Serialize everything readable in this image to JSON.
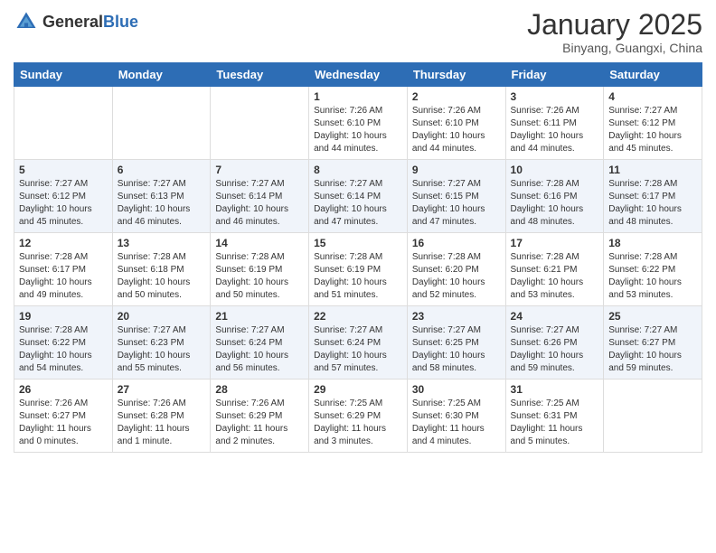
{
  "header": {
    "logo_general": "General",
    "logo_blue": "Blue",
    "title": "January 2025",
    "subtitle": "Binyang, Guangxi, China"
  },
  "weekdays": [
    "Sunday",
    "Monday",
    "Tuesday",
    "Wednesday",
    "Thursday",
    "Friday",
    "Saturday"
  ],
  "weeks": [
    [
      {
        "day": "",
        "sunrise": "",
        "sunset": "",
        "daylight": ""
      },
      {
        "day": "",
        "sunrise": "",
        "sunset": "",
        "daylight": ""
      },
      {
        "day": "",
        "sunrise": "",
        "sunset": "",
        "daylight": ""
      },
      {
        "day": "1",
        "sunrise": "Sunrise: 7:26 AM",
        "sunset": "Sunset: 6:10 PM",
        "daylight": "Daylight: 10 hours and 44 minutes."
      },
      {
        "day": "2",
        "sunrise": "Sunrise: 7:26 AM",
        "sunset": "Sunset: 6:10 PM",
        "daylight": "Daylight: 10 hours and 44 minutes."
      },
      {
        "day": "3",
        "sunrise": "Sunrise: 7:26 AM",
        "sunset": "Sunset: 6:11 PM",
        "daylight": "Daylight: 10 hours and 44 minutes."
      },
      {
        "day": "4",
        "sunrise": "Sunrise: 7:27 AM",
        "sunset": "Sunset: 6:12 PM",
        "daylight": "Daylight: 10 hours and 45 minutes."
      }
    ],
    [
      {
        "day": "5",
        "sunrise": "Sunrise: 7:27 AM",
        "sunset": "Sunset: 6:12 PM",
        "daylight": "Daylight: 10 hours and 45 minutes."
      },
      {
        "day": "6",
        "sunrise": "Sunrise: 7:27 AM",
        "sunset": "Sunset: 6:13 PM",
        "daylight": "Daylight: 10 hours and 46 minutes."
      },
      {
        "day": "7",
        "sunrise": "Sunrise: 7:27 AM",
        "sunset": "Sunset: 6:14 PM",
        "daylight": "Daylight: 10 hours and 46 minutes."
      },
      {
        "day": "8",
        "sunrise": "Sunrise: 7:27 AM",
        "sunset": "Sunset: 6:14 PM",
        "daylight": "Daylight: 10 hours and 47 minutes."
      },
      {
        "day": "9",
        "sunrise": "Sunrise: 7:27 AM",
        "sunset": "Sunset: 6:15 PM",
        "daylight": "Daylight: 10 hours and 47 minutes."
      },
      {
        "day": "10",
        "sunrise": "Sunrise: 7:28 AM",
        "sunset": "Sunset: 6:16 PM",
        "daylight": "Daylight: 10 hours and 48 minutes."
      },
      {
        "day": "11",
        "sunrise": "Sunrise: 7:28 AM",
        "sunset": "Sunset: 6:17 PM",
        "daylight": "Daylight: 10 hours and 48 minutes."
      }
    ],
    [
      {
        "day": "12",
        "sunrise": "Sunrise: 7:28 AM",
        "sunset": "Sunset: 6:17 PM",
        "daylight": "Daylight: 10 hours and 49 minutes."
      },
      {
        "day": "13",
        "sunrise": "Sunrise: 7:28 AM",
        "sunset": "Sunset: 6:18 PM",
        "daylight": "Daylight: 10 hours and 50 minutes."
      },
      {
        "day": "14",
        "sunrise": "Sunrise: 7:28 AM",
        "sunset": "Sunset: 6:19 PM",
        "daylight": "Daylight: 10 hours and 50 minutes."
      },
      {
        "day": "15",
        "sunrise": "Sunrise: 7:28 AM",
        "sunset": "Sunset: 6:19 PM",
        "daylight": "Daylight: 10 hours and 51 minutes."
      },
      {
        "day": "16",
        "sunrise": "Sunrise: 7:28 AM",
        "sunset": "Sunset: 6:20 PM",
        "daylight": "Daylight: 10 hours and 52 minutes."
      },
      {
        "day": "17",
        "sunrise": "Sunrise: 7:28 AM",
        "sunset": "Sunset: 6:21 PM",
        "daylight": "Daylight: 10 hours and 53 minutes."
      },
      {
        "day": "18",
        "sunrise": "Sunrise: 7:28 AM",
        "sunset": "Sunset: 6:22 PM",
        "daylight": "Daylight: 10 hours and 53 minutes."
      }
    ],
    [
      {
        "day": "19",
        "sunrise": "Sunrise: 7:28 AM",
        "sunset": "Sunset: 6:22 PM",
        "daylight": "Daylight: 10 hours and 54 minutes."
      },
      {
        "day": "20",
        "sunrise": "Sunrise: 7:27 AM",
        "sunset": "Sunset: 6:23 PM",
        "daylight": "Daylight: 10 hours and 55 minutes."
      },
      {
        "day": "21",
        "sunrise": "Sunrise: 7:27 AM",
        "sunset": "Sunset: 6:24 PM",
        "daylight": "Daylight: 10 hours and 56 minutes."
      },
      {
        "day": "22",
        "sunrise": "Sunrise: 7:27 AM",
        "sunset": "Sunset: 6:24 PM",
        "daylight": "Daylight: 10 hours and 57 minutes."
      },
      {
        "day": "23",
        "sunrise": "Sunrise: 7:27 AM",
        "sunset": "Sunset: 6:25 PM",
        "daylight": "Daylight: 10 hours and 58 minutes."
      },
      {
        "day": "24",
        "sunrise": "Sunrise: 7:27 AM",
        "sunset": "Sunset: 6:26 PM",
        "daylight": "Daylight: 10 hours and 59 minutes."
      },
      {
        "day": "25",
        "sunrise": "Sunrise: 7:27 AM",
        "sunset": "Sunset: 6:27 PM",
        "daylight": "Daylight: 10 hours and 59 minutes."
      }
    ],
    [
      {
        "day": "26",
        "sunrise": "Sunrise: 7:26 AM",
        "sunset": "Sunset: 6:27 PM",
        "daylight": "Daylight: 11 hours and 0 minutes."
      },
      {
        "day": "27",
        "sunrise": "Sunrise: 7:26 AM",
        "sunset": "Sunset: 6:28 PM",
        "daylight": "Daylight: 11 hours and 1 minute."
      },
      {
        "day": "28",
        "sunrise": "Sunrise: 7:26 AM",
        "sunset": "Sunset: 6:29 PM",
        "daylight": "Daylight: 11 hours and 2 minutes."
      },
      {
        "day": "29",
        "sunrise": "Sunrise: 7:25 AM",
        "sunset": "Sunset: 6:29 PM",
        "daylight": "Daylight: 11 hours and 3 minutes."
      },
      {
        "day": "30",
        "sunrise": "Sunrise: 7:25 AM",
        "sunset": "Sunset: 6:30 PM",
        "daylight": "Daylight: 11 hours and 4 minutes."
      },
      {
        "day": "31",
        "sunrise": "Sunrise: 7:25 AM",
        "sunset": "Sunset: 6:31 PM",
        "daylight": "Daylight: 11 hours and 5 minutes."
      },
      {
        "day": "",
        "sunrise": "",
        "sunset": "",
        "daylight": ""
      }
    ]
  ]
}
